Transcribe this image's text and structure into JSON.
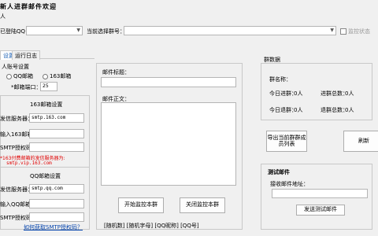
{
  "window": {
    "title": "新人进群邮件欢迎",
    "subtitle": "人"
  },
  "top": {
    "qq_label": "已登陆QQ",
    "qq_value": "",
    "group_label": "当前选择群号：",
    "group_value": "",
    "monitor_status_label": "监控状态"
  },
  "tabs": [
    {
      "label": "设置"
    },
    {
      "label": "运行日志"
    }
  ],
  "settings": {
    "account_group_title": "人账号设置",
    "radio_qq": "QQ邮箱",
    "radio_163": "163邮箱",
    "port_label": "*邮箱端口：",
    "port_value": "25",
    "box163": {
      "title": "163邮箱设置",
      "server_label": "发信服务器：",
      "server_value": "smtp.163.com",
      "email_label": "输入163邮箱：",
      "email_value": "",
      "auth_label": "SMTP授权码：",
      "auth_value": "",
      "warning": "*163付费邮箱的发信服务器为:",
      "warning_server": "smtp.vip.163.com"
    },
    "boxqq": {
      "title": "QQ邮箱设置",
      "server_label": "发信服务器：",
      "server_value": "smtp.qq.com",
      "email_label": "输入QQ邮箱：",
      "email_value": "",
      "auth_label": "SMTP授权码：",
      "auth_value": "",
      "help_link": "如何获取SMTP授权码？"
    }
  },
  "mail": {
    "subject_label": "邮件标题：",
    "subject_value": "",
    "body_label": "邮件正文：",
    "body_value": "",
    "start_button": "开始监控本群",
    "stop_button": "关闭监控本群",
    "variables": "[随机数] [随机字母] [QQ昵称] [QQ号]"
  },
  "group_data": {
    "title": "群数据",
    "name_label": "群名称：",
    "name_value": "",
    "today_in_label": "今日进群：",
    "today_in_value": "0人",
    "total_in_label": "进群总数：",
    "total_in_value": "0人",
    "today_out_label": "今日退群：",
    "today_out_value": "0人",
    "total_out_label": "退群总数：",
    "total_out_value": "0人",
    "export_button": "导出当前群群成员列表",
    "refresh_button": "刷新"
  },
  "test_mail": {
    "title": "测试邮件",
    "address_label": "接收邮件地址：",
    "address_value": "",
    "send_button": "发送测试邮件"
  }
}
